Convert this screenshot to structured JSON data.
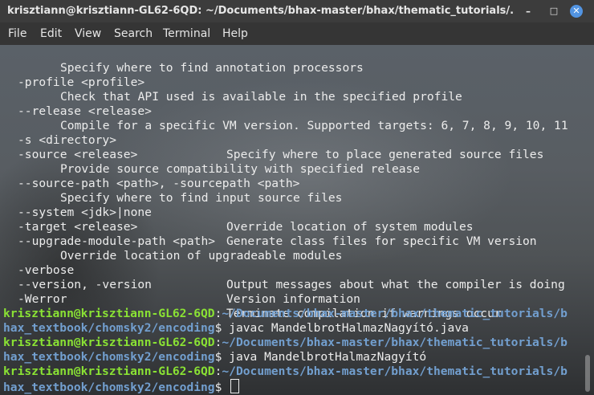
{
  "window": {
    "title": "krisztiann@krisztiann-GL62-6QD: ~/Documents/bhax-master/bhax/thematic_tutorials/...",
    "minimize_glyph": "–",
    "maximize_glyph": "□",
    "close_glyph": "✕"
  },
  "menu": [
    "File",
    "Edit",
    "View",
    "Search",
    "Terminal",
    "Help"
  ],
  "help_lines": [
    {
      "desc_indent": "Specify where to find annotation processors"
    },
    {
      "opt": "-profile <profile>"
    },
    {
      "desc_indent": "Check that API used is available in the specified profile"
    },
    {
      "opt": "--release <release>"
    },
    {
      "desc_indent": "Compile for a specific VM version. Supported targets: 6, 7, 8, 9, 10, 11"
    },
    {
      "opt": "-s <directory>",
      "desc": "Specify where to place generated source files"
    },
    {
      "opt": "-source <release>"
    },
    {
      "desc_indent": "Provide source compatibility with specified release"
    },
    {
      "opt": "--source-path <path>, -sourcepath <path>"
    },
    {
      "desc_indent": "Specify where to find input source files"
    },
    {
      "opt": "--system <jdk>|none",
      "desc": "Override location of system modules"
    },
    {
      "opt": "-target <release>",
      "desc": "Generate class files for specific VM version"
    },
    {
      "opt": "--upgrade-module-path <path>"
    },
    {
      "desc_indent": "Override location of upgradeable modules"
    },
    {
      "opt": "-verbose",
      "desc": "Output messages about what the compiler is doing"
    },
    {
      "opt": "--version, -version",
      "desc": "Version information"
    },
    {
      "opt": "-Werror",
      "desc": "Terminate compilation if warnings occur"
    }
  ],
  "prompts": [
    {
      "user": "krisztiann@krisztiann-GL62-6QD",
      "sep": ":",
      "path1": "~/Documents/bhax-master/bhax/thematic_tutorials/b",
      "path2": "hax_textbook/chomsky2/encoding",
      "dollar": "$ ",
      "command": "javac MandelbrotHalmazNagyító.java"
    },
    {
      "user": "krisztiann@krisztiann-GL62-6QD",
      "sep": ":",
      "path1": "~/Documents/bhax-master/bhax/thematic_tutorials/b",
      "path2": "hax_textbook/chomsky2/encoding",
      "dollar": "$ ",
      "command": "java MandelbrotHalmazNagyító"
    },
    {
      "user": "krisztiann@krisztiann-GL62-6QD",
      "sep": ":",
      "path1": "~/Documents/bhax-master/bhax/thematic_tutorials/b",
      "path2": "hax_textbook/chomsky2/encoding",
      "dollar": "$ ",
      "command": ""
    }
  ],
  "colors": {
    "prompt_user": "#8ae234",
    "prompt_path": "#729fcf",
    "text": "#ececec",
    "close_button": "#5294e2"
  }
}
